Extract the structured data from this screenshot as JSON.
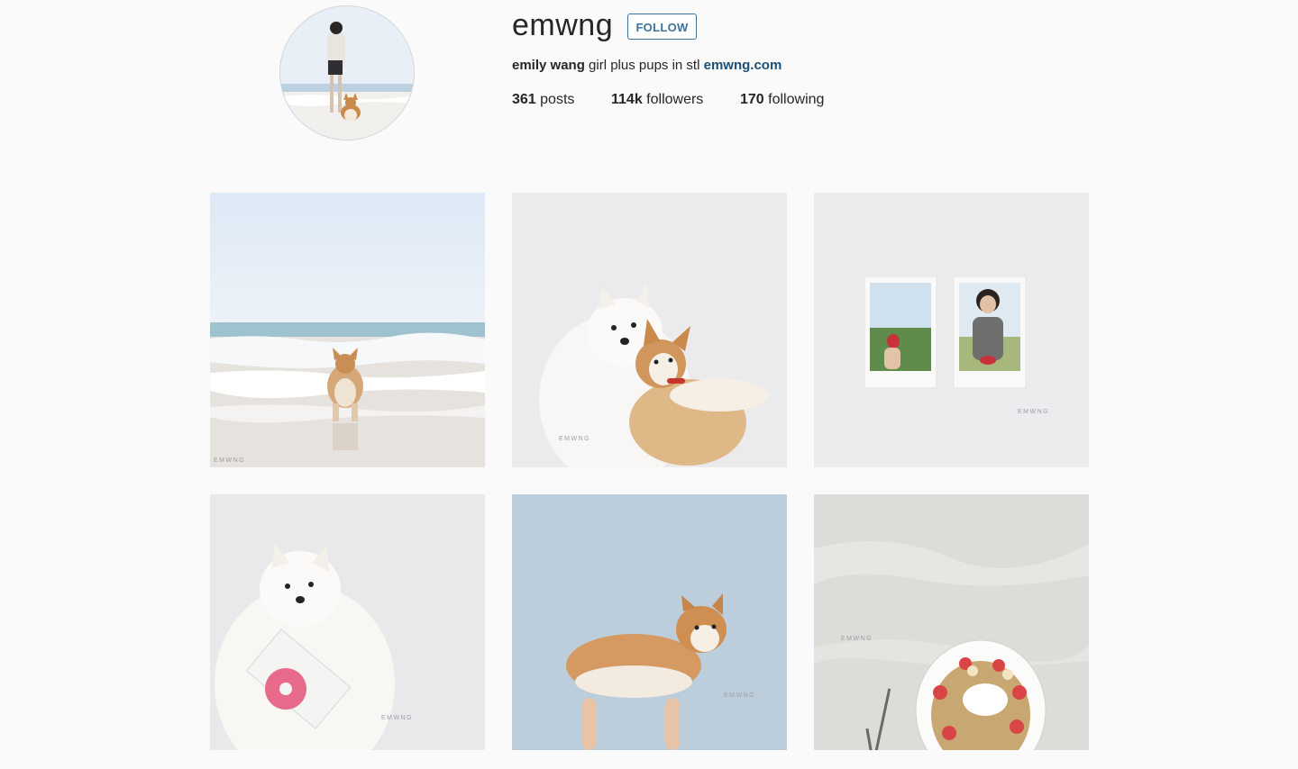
{
  "profile": {
    "username": "emwng",
    "follow_label": "FOLLOW",
    "full_name": "emily wang",
    "bio_text": "girl plus pups in stl",
    "website": "emwng.com",
    "stats": {
      "posts_count": "361",
      "posts_label": "posts",
      "followers_count": "114k",
      "followers_label": "followers",
      "following_count": "170",
      "following_label": "following"
    }
  },
  "posts": [
    {
      "subject": "corgi at beach",
      "watermark": "EMWNG"
    },
    {
      "subject": "white dog hugging corgi",
      "watermark": "EMWNG"
    },
    {
      "subject": "two instant photos on wall",
      "watermark": "EMWNG"
    },
    {
      "subject": "white dog holding donut plate",
      "watermark": "EMWNG"
    },
    {
      "subject": "corgi on blue background",
      "watermark": "EMWNG"
    },
    {
      "subject": "pancakes with strawberries",
      "watermark": "EMWNG"
    }
  ],
  "colors": {
    "background": "#fafafa",
    "link": "#1c4f78",
    "follow_button": "#3f729b"
  }
}
